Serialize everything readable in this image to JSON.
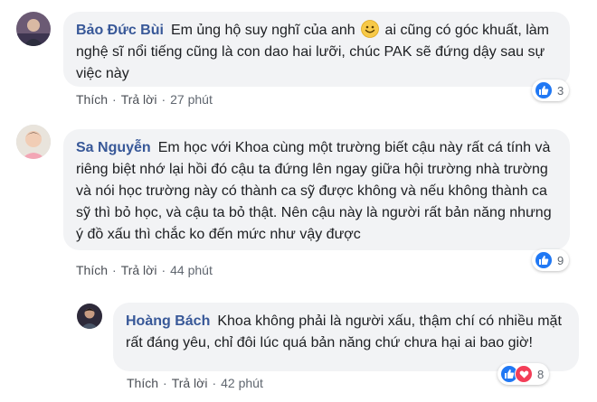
{
  "comments": [
    {
      "author": "Bảo Đức Bùi",
      "text_before_emoji": "Em ủng hộ suy nghĩ của anh",
      "emoji": "smiling-face-emoji",
      "text_after_emoji": "ai cũng có góc khuất, làm nghệ sĩ nổi tiếng cũng là con dao hai lưỡi, chúc PAK sẽ đứng dậy sau sự việc này",
      "like_label": "Thích",
      "reply_label": "Trả lời",
      "time": "27 phút",
      "reaction_count": "3",
      "reactions": [
        "like-icon"
      ]
    },
    {
      "author": "Sa Nguyễn",
      "text": "Em học với Khoa cùng một trường biết cậu này rất cá tính và riêng biệt nhớ lại hồi đó cậu ta đứng lên ngay giữa hội trường nhà trường và nói học trường này có thành ca sỹ được không và nếu không thành ca sỹ thì bỏ học, và cậu ta bỏ thật. Nên cậu này là người rất bản năng nhưng ý đồ xấu thì chắc ko đến mức như vậy được",
      "like_label": "Thích",
      "reply_label": "Trả lời",
      "time": "44 phút",
      "reaction_count": "9",
      "reactions": [
        "like-icon"
      ]
    },
    {
      "author": "Hoàng Bách",
      "text": "Khoa không phải là người xấu, thậm chí có nhiều mặt rất đáng yêu, chỉ đôi lúc quá bản năng chứ chưa hại ai bao giờ!",
      "like_label": "Thích",
      "reply_label": "Trả lời",
      "time": "42 phút",
      "reaction_count": "8",
      "reactions": [
        "like-icon",
        "love-icon"
      ]
    }
  ],
  "separator": "·",
  "colors": {
    "author": "#385898",
    "bubble": "#f2f3f5",
    "like": "#2078f4",
    "love": "#f33e58",
    "meta": "#606770"
  }
}
